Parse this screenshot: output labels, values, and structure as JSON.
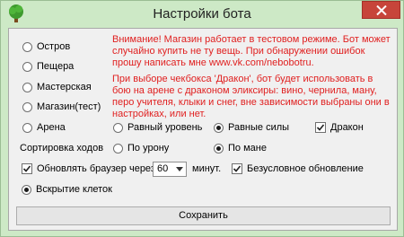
{
  "window": {
    "title": "Настройки бота",
    "icon": "tree-icon",
    "close_icon": "close-icon"
  },
  "locations": [
    {
      "label": "Остров",
      "checked": false
    },
    {
      "label": "Пещера",
      "checked": false
    },
    {
      "label": "Мастерская",
      "checked": false
    },
    {
      "label": "Магазин(тест)",
      "checked": false
    },
    {
      "label": "Арена",
      "checked": false
    }
  ],
  "notice": {
    "p1": "Внимание! Магазин работает в тестовом режиме. Бот может случайно купить не ту вещь. При обнаружении ошибок прошу написать мне www.vk.com/nebobotru.",
    "p2": "При выборе чекбокса 'Дракон', бот будет использовать в бою на арене с драконом эликсиры: вино, чернила, ману, перо учителя, клыки и снег, вне зависимости выбраны они в настройках, или нет."
  },
  "arena": {
    "level_options": [
      {
        "label": "Равный уровень",
        "checked": false
      },
      {
        "label": "Равные силы",
        "checked": true
      }
    ],
    "dragon": {
      "label": "Дракон",
      "checked": true
    }
  },
  "sort": {
    "label": "Сортировка ходов",
    "options": [
      {
        "label": "По урону",
        "checked": false
      },
      {
        "label": "По мане",
        "checked": true
      }
    ]
  },
  "refresh": {
    "label": "Обновлять браузер через",
    "checked": true,
    "value": "60",
    "unit": "минут.",
    "unconditional": {
      "label": "Безусловное обновление",
      "checked": true
    }
  },
  "open_cells": {
    "label": "Вскрытие клеток",
    "checked": true
  },
  "save_label": "Сохранить"
}
